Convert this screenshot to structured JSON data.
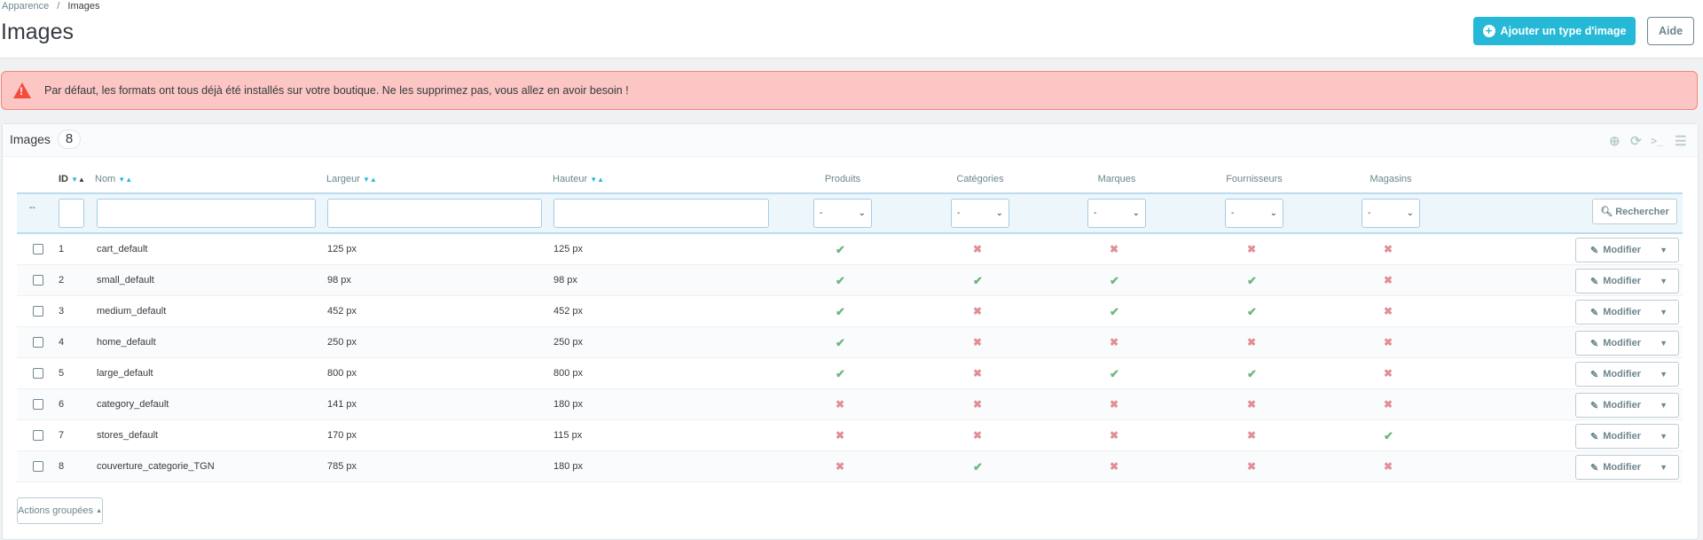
{
  "breadcrumb": {
    "parent": "Apparence",
    "sep": "/",
    "current": "Images"
  },
  "page_title": "Images",
  "toolbar": {
    "add_label": "Ajouter un type d'image",
    "help_label": "Aide"
  },
  "alert": {
    "message": "Par défaut, les formats ont tous déjà été installés sur votre boutique. Ne les supprimez pas, vous allez en avoir besoin !"
  },
  "panel": {
    "title": "Images",
    "count": "8"
  },
  "columns": {
    "id": "ID",
    "name": "Nom",
    "width": "Largeur",
    "height": "Hauteur",
    "products": "Produits",
    "categories": "Catégories",
    "brands": "Marques",
    "suppliers": "Fournisseurs",
    "stores": "Magasins"
  },
  "filter": {
    "reset": "--",
    "select_value": "-",
    "search_label": "Rechercher"
  },
  "rows": [
    {
      "id": "1",
      "name": "cart_default",
      "width": "125 px",
      "height": "125 px",
      "flags": [
        1,
        0,
        0,
        0,
        0
      ]
    },
    {
      "id": "2",
      "name": "small_default",
      "width": "98 px",
      "height": "98 px",
      "flags": [
        1,
        1,
        1,
        1,
        0
      ]
    },
    {
      "id": "3",
      "name": "medium_default",
      "width": "452 px",
      "height": "452 px",
      "flags": [
        1,
        0,
        1,
        1,
        0
      ]
    },
    {
      "id": "4",
      "name": "home_default",
      "width": "250 px",
      "height": "250 px",
      "flags": [
        1,
        0,
        0,
        0,
        0
      ]
    },
    {
      "id": "5",
      "name": "large_default",
      "width": "800 px",
      "height": "800 px",
      "flags": [
        1,
        0,
        1,
        1,
        0
      ]
    },
    {
      "id": "6",
      "name": "category_default",
      "width": "141 px",
      "height": "180 px",
      "flags": [
        0,
        0,
        0,
        0,
        0
      ]
    },
    {
      "id": "7",
      "name": "stores_default",
      "width": "170 px",
      "height": "115 px",
      "flags": [
        0,
        0,
        0,
        0,
        1
      ]
    },
    {
      "id": "8",
      "name": "couverture_categorie_TGN",
      "width": "785 px",
      "height": "180 px",
      "flags": [
        0,
        1,
        0,
        0,
        0
      ]
    }
  ],
  "row_action": "Modifier",
  "bulk_label": "Actions groupées",
  "colors": {
    "accent": "#25b9d7",
    "ok": "#70b580",
    "ko": "#e08f95",
    "alert_bg": "#fbc6c3"
  }
}
